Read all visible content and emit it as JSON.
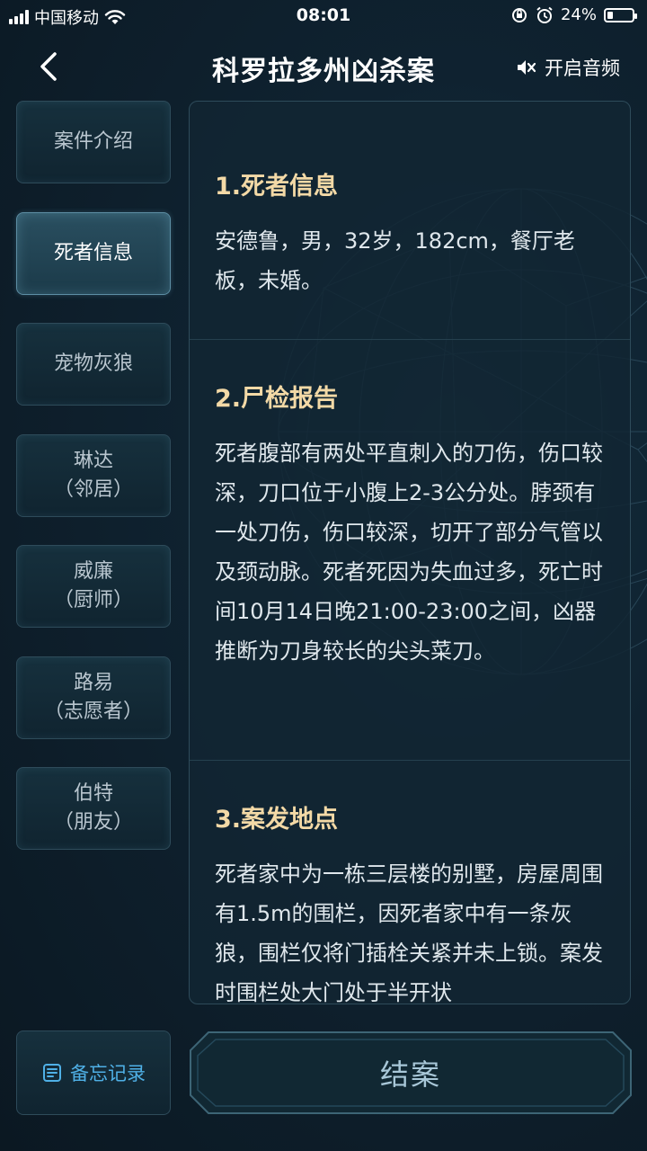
{
  "status_bar": {
    "carrier": "中国移动",
    "time": "08:01",
    "battery": "24%",
    "battery_level": 0.24,
    "icons": [
      "signal-icon",
      "wifi-icon",
      "orientation-lock-icon",
      "alarm-icon",
      "battery-icon"
    ]
  },
  "header": {
    "title": "科罗拉多州凶杀案",
    "sound_label": "开启音频",
    "icons": [
      "back-icon",
      "speaker-muted-icon"
    ]
  },
  "sidebar": {
    "items": [
      {
        "line1": "案件介绍",
        "line2": ""
      },
      {
        "line1": "死者信息",
        "line2": ""
      },
      {
        "line1": "宠物灰狼",
        "line2": ""
      },
      {
        "line1": "琳达",
        "line2": "（邻居）"
      },
      {
        "line1": "威廉",
        "line2": "（厨师）"
      },
      {
        "line1": "路易",
        "line2": "（志愿者）"
      },
      {
        "line1": "伯特",
        "line2": "（朋友）"
      }
    ],
    "active_index": 1
  },
  "content": {
    "sections": [
      {
        "title": "1.死者信息",
        "body": "安德鲁，男，32岁，182cm，餐厅老板，未婚。"
      },
      {
        "title": "2.尸检报告",
        "body": "死者腹部有两处平直刺入的刀伤，伤口较深，刀口位于小腹上2-3公分处。脖颈有一处刀伤，伤口较深，切开了部分气管以及颈动脉。死者死因为失血过多，死亡时间10月14日晚21:00-23:00之间，凶器推断为刀身较长的尖头菜刀。"
      },
      {
        "title": "3.案发地点",
        "body": "死者家中为一栋三层楼的别墅，房屋周围有1.5m的围栏，因死者家中有一条灰狼，围栏仅将门插栓关紧并未上锁。案发时围栏处大门处于半开状"
      }
    ]
  },
  "footer": {
    "memo_label": "备忘记录",
    "close_case_label": "结案",
    "icons": [
      "memo-list-icon"
    ]
  },
  "colors": {
    "background": "#0d1c27",
    "section_title": "#f3d9a6",
    "memo_accent": "#4fb0e6",
    "active_item_border": "#5d8ea4"
  }
}
